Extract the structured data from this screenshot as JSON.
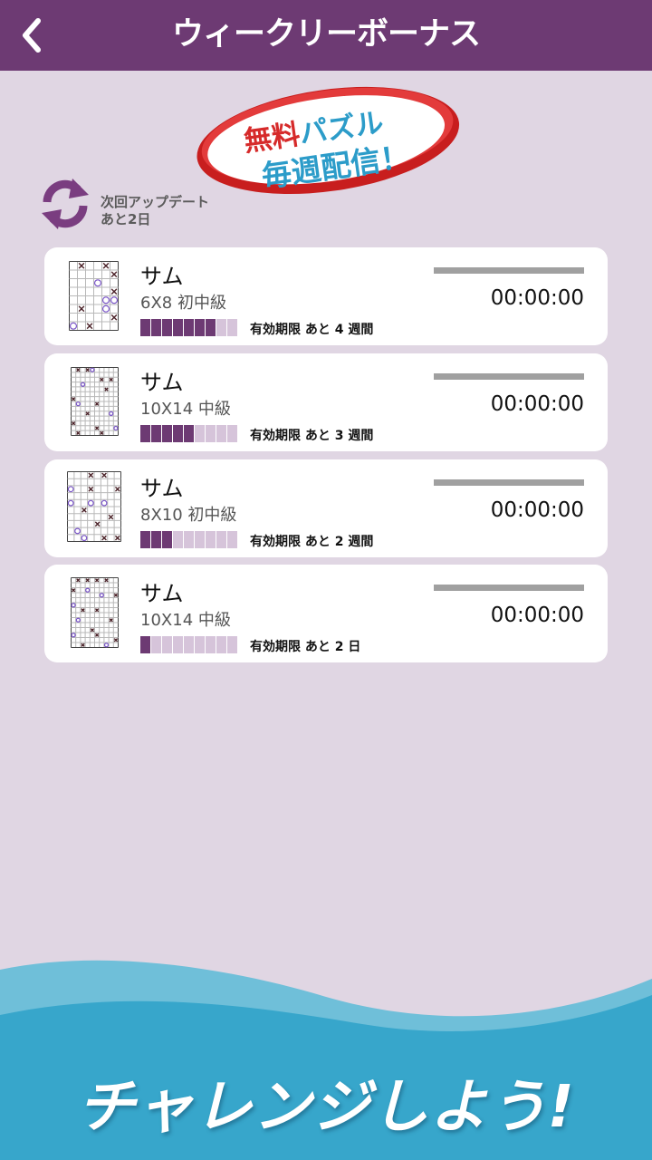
{
  "header": {
    "title": "ウィークリーボーナス",
    "back_icon": "chevron-left-icon"
  },
  "badge": {
    "line1_red": "無料",
    "line1_blue": "パズル",
    "line2": "毎週配信！"
  },
  "update": {
    "line1": "次回アップデート",
    "line2": "あと2日",
    "icon": "refresh-icon"
  },
  "puzzles": [
    {
      "name": "サム",
      "size": "6X8 初中級",
      "expiry": "有効期限 あと 4 週間",
      "time": "00:00:00",
      "remaining_segments": 7,
      "total_segments": 9,
      "grid_cols": 6,
      "grid_rows": 8
    },
    {
      "name": "サム",
      "size": "10X14 中級",
      "expiry": "有効期限 あと 3 週間",
      "time": "00:00:00",
      "remaining_segments": 5,
      "total_segments": 9,
      "grid_cols": 10,
      "grid_rows": 14
    },
    {
      "name": "サム",
      "size": "8X10 初中級",
      "expiry": "有効期限 あと 2 週間",
      "time": "00:00:00",
      "remaining_segments": 3,
      "total_segments": 9,
      "grid_cols": 8,
      "grid_rows": 10
    },
    {
      "name": "サム",
      "size": "10X14 中級",
      "expiry": "有効期限 あと 2 日",
      "time": "00:00:00",
      "remaining_segments": 1,
      "total_segments": 9,
      "grid_cols": 10,
      "grid_rows": 14
    }
  ],
  "footer": {
    "text": "チャレンジしよう!"
  },
  "colors": {
    "header": "#6d3a73",
    "background": "#e0d6e3",
    "accent": "#6d3a73",
    "segment_off": "#d6c4da",
    "wave_dark": "#37a6cb",
    "wave_light": "#6fbfd9"
  }
}
